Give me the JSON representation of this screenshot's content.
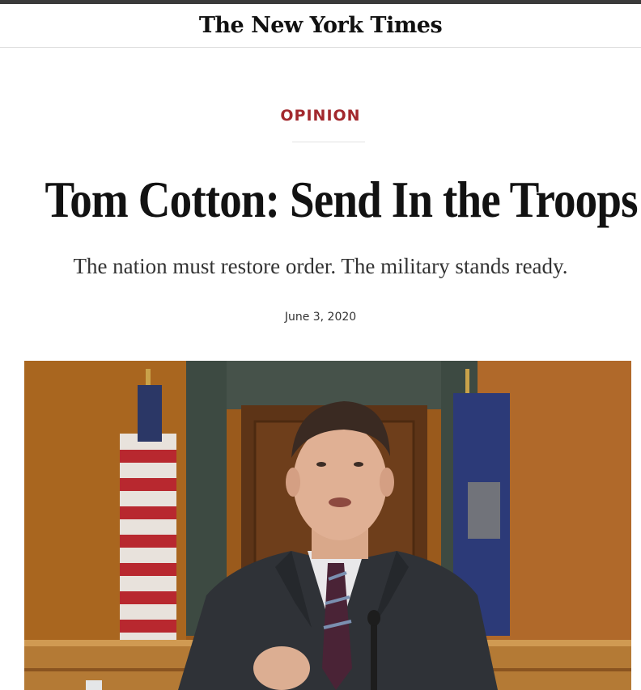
{
  "masthead": {
    "logo": "The New York Times"
  },
  "article": {
    "section": "OPINION",
    "headline": "Tom Cotton: Send In the Troops",
    "dek": "The nation must restore order. The military stands ready.",
    "date": "June 3, 2020"
  },
  "colors": {
    "kicker": "#a2282d",
    "text": "#121212"
  },
  "icons": {
    "logo": "nyt-wordmark"
  }
}
